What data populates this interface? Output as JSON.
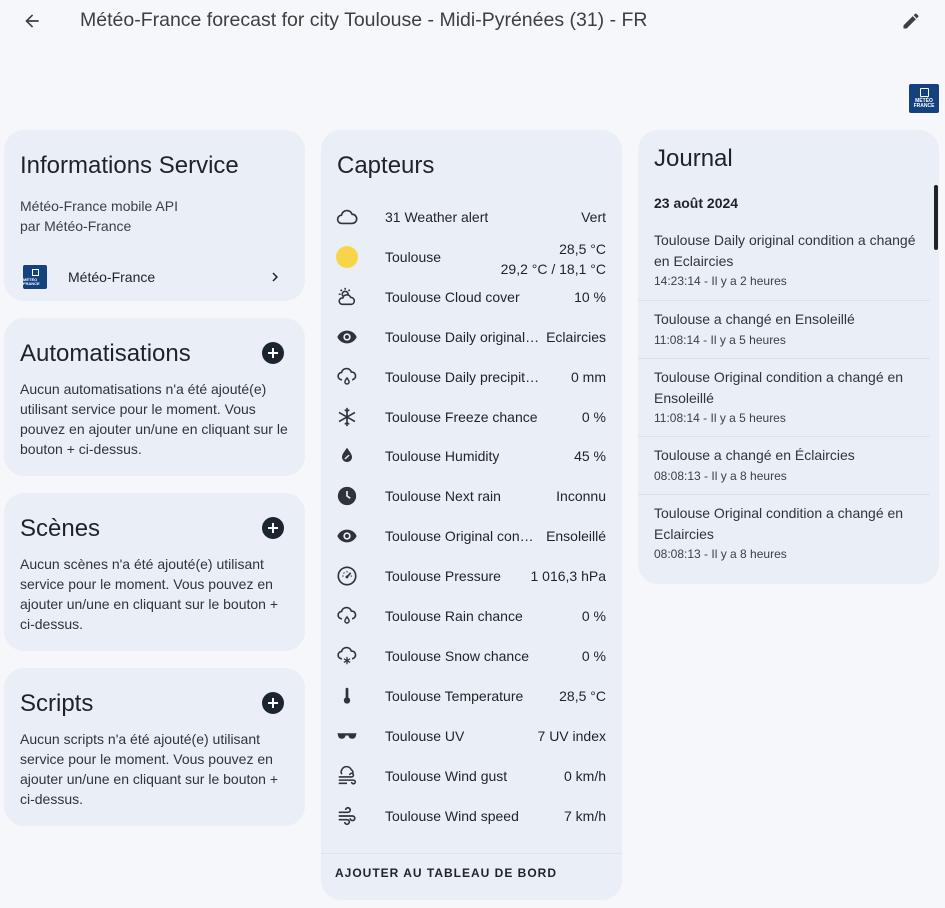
{
  "header": {
    "title": "Météo-France forecast for city Toulouse - Midi-Pyrénées (31) - FR"
  },
  "brand_logo": {
    "text": "MÉTÉO FRANCE",
    "color": "#13427f"
  },
  "info": {
    "title": "Informations Service",
    "line1": "Météo-France mobile API",
    "line2": "par Météo-France",
    "integration": "Météo-France"
  },
  "automations": {
    "title": "Automatisations",
    "desc": "Aucun automatisations n'a été ajouté(e) utilisant service pour le moment. Vous pouvez en ajouter un/une en cliquant sur le bouton + ci-dessus."
  },
  "scenes": {
    "title": "Scènes",
    "desc": "Aucun scènes n'a été ajouté(e) utilisant service pour le moment. Vous pouvez en ajouter un/une en cliquant sur le bouton + ci-dessus."
  },
  "scripts": {
    "title": "Scripts",
    "desc": "Aucun scripts n'a été ajouté(e) utilisant service pour le moment. Vous pouvez en ajouter un/une en cliquant sur le bouton + ci-dessus."
  },
  "sensors": {
    "title": "Capteurs",
    "add_button": "AJOUTER AU TABLEAU DE BORD",
    "items": [
      {
        "icon": "cloud-alert-icon",
        "name": "31 Weather alert",
        "value": "Vert"
      },
      {
        "icon": "sun-icon",
        "name": "Toulouse",
        "value": "28,5 °C",
        "value2": "29,2 °C / 18,1 °C"
      },
      {
        "icon": "cloud-cover-icon",
        "name": "Toulouse Cloud cover",
        "value": "10 %"
      },
      {
        "icon": "eye-icon",
        "name": "Toulouse Daily original…",
        "value": "Eclaircies"
      },
      {
        "icon": "precipitation-icon",
        "name": "Toulouse Daily precipitation",
        "value": "0 mm"
      },
      {
        "icon": "snowflake-icon",
        "name": "Toulouse Freeze chance",
        "value": "0 %"
      },
      {
        "icon": "humidity-icon",
        "name": "Toulouse Humidity",
        "value": "45 %"
      },
      {
        "icon": "clock-icon",
        "name": "Toulouse Next rain",
        "value": "Inconnu"
      },
      {
        "icon": "eye-icon",
        "name": "Toulouse Original con…",
        "value": "Ensoleillé"
      },
      {
        "icon": "gauge-icon",
        "name": "Toulouse Pressure",
        "value": "1 016,3 hPa"
      },
      {
        "icon": "rain-chance-icon",
        "name": "Toulouse Rain chance",
        "value": "0 %"
      },
      {
        "icon": "snow-chance-icon",
        "name": "Toulouse Snow chance",
        "value": "0 %"
      },
      {
        "icon": "thermometer-icon",
        "name": "Toulouse Temperature",
        "value": "28,5 °C"
      },
      {
        "icon": "sunglasses-icon",
        "name": "Toulouse UV",
        "value": "7 UV index"
      },
      {
        "icon": "wind-gust-icon",
        "name": "Toulouse Wind gust",
        "value": "0 km/h"
      },
      {
        "icon": "wind-icon",
        "name": "Toulouse Wind speed",
        "value": "7 km/h"
      }
    ]
  },
  "journal": {
    "title": "Journal",
    "date": "23 août 2024",
    "entries": [
      {
        "msg": "Toulouse Daily original condition a changé en Eclaircies",
        "time": "14:23:14 - Il y a 2 heures"
      },
      {
        "msg": "Toulouse a changé en Ensoleillé",
        "time": "11:08:14 - Il y a 5 heures"
      },
      {
        "msg": "Toulouse Original condition a changé en Ensoleillé",
        "time": "11:08:14 - Il y a 5 heures"
      },
      {
        "msg": "Toulouse a changé en Éclaircies",
        "time": "08:08:13 - Il y a 8 heures"
      },
      {
        "msg": "Toulouse Original condition a changé en Eclaircies",
        "time": "08:08:13 - Il y a 8 heures"
      }
    ]
  }
}
